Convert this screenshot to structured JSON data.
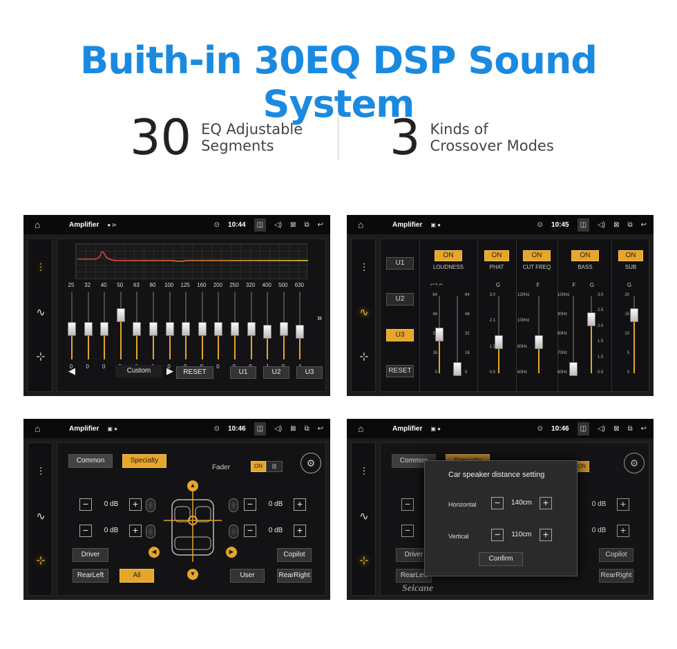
{
  "headline": "Buith-in 30EQ DSP Sound System",
  "features": [
    {
      "num": "30",
      "line1": "EQ Adjustable",
      "line2": "Segments"
    },
    {
      "num": "3",
      "line1": "Kinds of",
      "line2": "Crossover Modes"
    }
  ],
  "app_title": "Amplifier",
  "times": [
    "10:44",
    "10:45",
    "10:46",
    "10:46"
  ],
  "eq": {
    "freqs": [
      "25",
      "32",
      "40",
      "50",
      "63",
      "80",
      "100",
      "125",
      "160",
      "200",
      "250",
      "320",
      "400",
      "500",
      "630"
    ],
    "gains": [
      "0",
      "0",
      "0",
      "5",
      "0",
      "0",
      "0",
      "0",
      "0",
      "0",
      "0",
      "0",
      "-1",
      "0",
      "-1"
    ],
    "gain_levels": [
      0,
      0,
      0,
      5,
      0,
      0,
      0,
      0,
      0,
      0,
      0,
      0,
      -1,
      0,
      -1
    ],
    "preset": "Custom",
    "reset": "RESET",
    "u1": "U1",
    "u2": "U2",
    "u3": "U3"
  },
  "crossover": {
    "u1": "U1",
    "u2": "U2",
    "u3": "U3",
    "reset": "RESET",
    "on": "ON",
    "channels": [
      "LOUDNESS",
      "PHAT",
      "CUT FREQ",
      "BASS",
      "SUB"
    ],
    "phat_letter": "G",
    "cut_letter": "F",
    "bass_letter_f": "F",
    "bass_letter_g": "G",
    "sub_letter": "G",
    "loud_scale": [
      "64",
      "48",
      "32",
      "16",
      "0"
    ],
    "phat_scale": [
      "3.0",
      "2.1",
      "1.3",
      "0.5"
    ],
    "cut_scale": [
      "120Hz",
      "100Hz",
      "80Hz",
      "60Hz"
    ],
    "bass_f_scale": [
      "100Hz",
      "90Hz",
      "80Hz",
      "70Hz",
      "60Hz"
    ],
    "bass_g_scale": [
      "3.0",
      "2.5",
      "2.0",
      "1.5",
      "1.0",
      "0.5"
    ],
    "sub_scale": [
      "20",
      "15",
      "10",
      "5",
      "0"
    ]
  },
  "fader": {
    "common": "Common",
    "specialty": "Specialty",
    "fader_label": "Fader",
    "toggle_on": "ON",
    "db_values": [
      "0 dB",
      "0 dB",
      "0 dB",
      "0 dB"
    ],
    "minus": "−",
    "plus": "+",
    "driver": "Driver",
    "copilot": "Copilot",
    "rearleft": "RearLeft",
    "all": "All",
    "user": "User",
    "rearright": "RearRight"
  },
  "distance": {
    "title": "Car speaker distance setting",
    "horizontal_label": "Horizontal",
    "horizontal_value": "140cm",
    "vertical_label": "Vertical",
    "vertical_value": "110cm",
    "confirm": "Confirm",
    "brand": "Seicane"
  },
  "colors": {
    "accent": "#1a8ae0",
    "active": "#e7a52a"
  }
}
